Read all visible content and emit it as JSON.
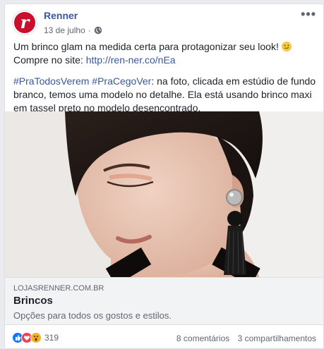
{
  "post": {
    "page_name": "Renner",
    "avatar_letter": "r",
    "date": "13 de julho",
    "meta_separator": "·",
    "more_label": "•••",
    "text_1": "Um brinco glam na medida certa para protagonizar seu look!",
    "text_1_b": " Compre no site: ",
    "link_url": "http://ren-ner.co/nEa",
    "hashtags": "#PraTodosVerem #PraCegoVer",
    "text_2": ": na foto, clicada em estúdio de fundo branco, temos uma modelo no detalhe. Ela está usando brinco maxi em tassel preto no modelo desencontrado."
  },
  "link_preview": {
    "domain": "LOJASRENNER.COM.BR",
    "title": "Brincos",
    "description": "Opções para todos os gostos e estilos."
  },
  "footer": {
    "reaction_count": "319",
    "comments": "8 comentários",
    "shares": "3 compartilhamentos"
  },
  "colors": {
    "brand": "#c8102e",
    "link": "#385898"
  }
}
